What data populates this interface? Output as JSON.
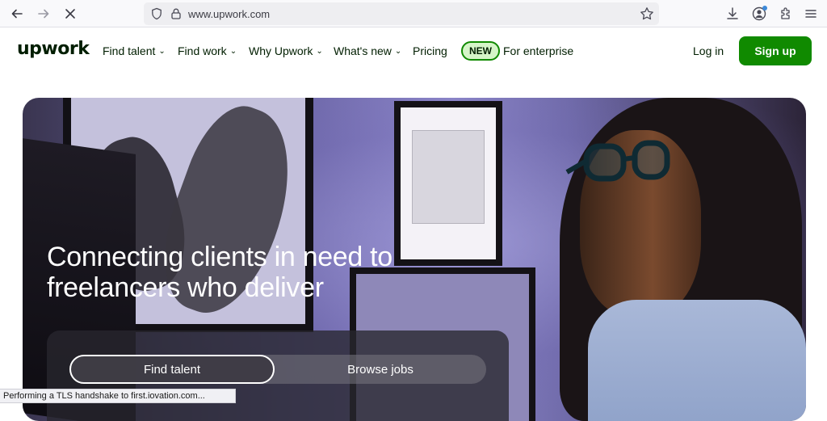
{
  "browser": {
    "url": "www.upwork.com",
    "back_icon": "back-arrow-icon",
    "forward_icon": "forward-arrow-icon",
    "stop_icon": "close-icon",
    "status_text": "Performing a TLS handshake to first.iovation.com..."
  },
  "header": {
    "logo": "upwork",
    "nav": [
      {
        "label": "Find talent",
        "has_dropdown": true
      },
      {
        "label": "Find work",
        "has_dropdown": true
      },
      {
        "label": "Why Upwork",
        "has_dropdown": true
      },
      {
        "label": "What's new",
        "has_dropdown": true
      },
      {
        "label": "Pricing",
        "has_dropdown": false
      }
    ],
    "badge": "NEW",
    "enterprise": "For enterprise",
    "login": "Log in",
    "signup": "Sign up",
    "brand_color": "#108a00"
  },
  "hero": {
    "title": "Connecting clients in need to freelancers who deliver",
    "tabs": {
      "find_talent": "Find talent",
      "browse_jobs": "Browse jobs"
    }
  }
}
